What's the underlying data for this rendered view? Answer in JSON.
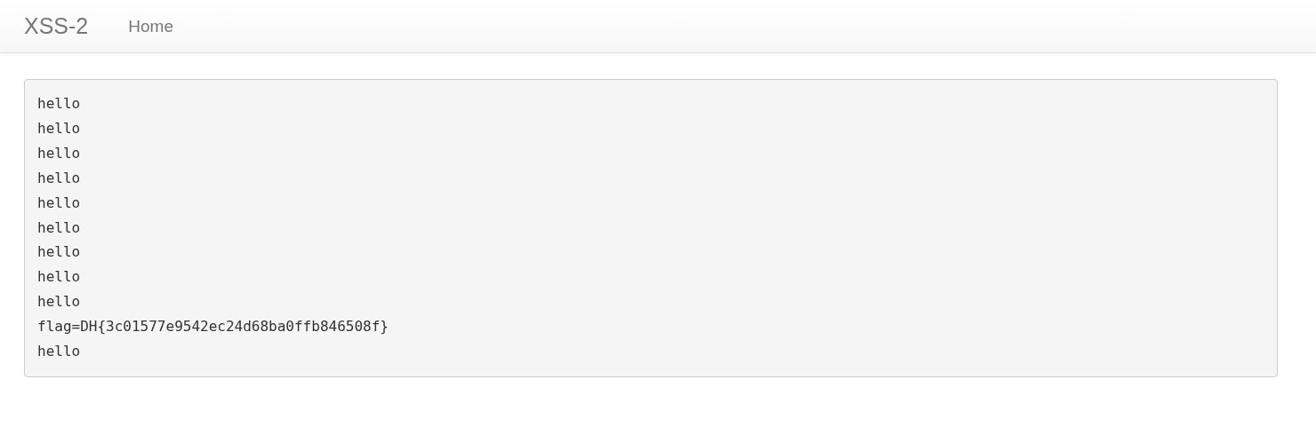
{
  "navbar": {
    "brand": "XSS-2",
    "links": [
      {
        "label": "Home"
      }
    ]
  },
  "output": {
    "lines": [
      "hello",
      "hello",
      "hello",
      "hello",
      "hello",
      "hello",
      "hello",
      "hello",
      "hello",
      "flag=DH{3c01577e9542ec24d68ba0ffb846508f}",
      "hello"
    ]
  }
}
